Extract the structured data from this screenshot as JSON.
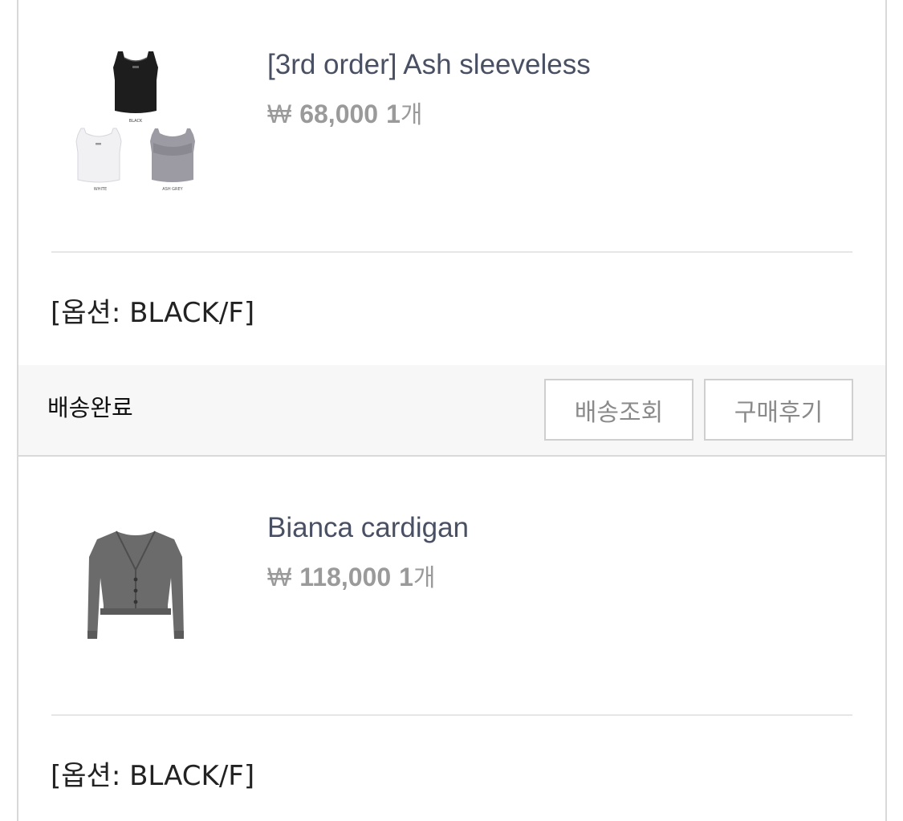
{
  "orders": [
    {
      "product_name": "[3rd order] Ash sleeveless",
      "currency_symbol": "₩",
      "price": "68,000",
      "quantity": "1",
      "quantity_unit": "개",
      "option_text": "[옵션: BLACK/F]",
      "image_labels": [
        "BLACK",
        "WHITE",
        "ASH GREY"
      ]
    },
    {
      "product_name": "Bianca cardigan",
      "currency_symbol": "₩",
      "price": "118,000",
      "quantity": "1",
      "quantity_unit": "개",
      "option_text": "[옵션: BLACK/F]"
    }
  ],
  "status": {
    "label": "배송완료",
    "track_button": "배송조회",
    "review_button": "구매후기"
  },
  "colors": {
    "name": "#4a5063",
    "price": "#9a9a9a",
    "status_bg": "#f7f7f7",
    "button_border": "#cfcfcf",
    "button_text": "#8a8a8a"
  }
}
